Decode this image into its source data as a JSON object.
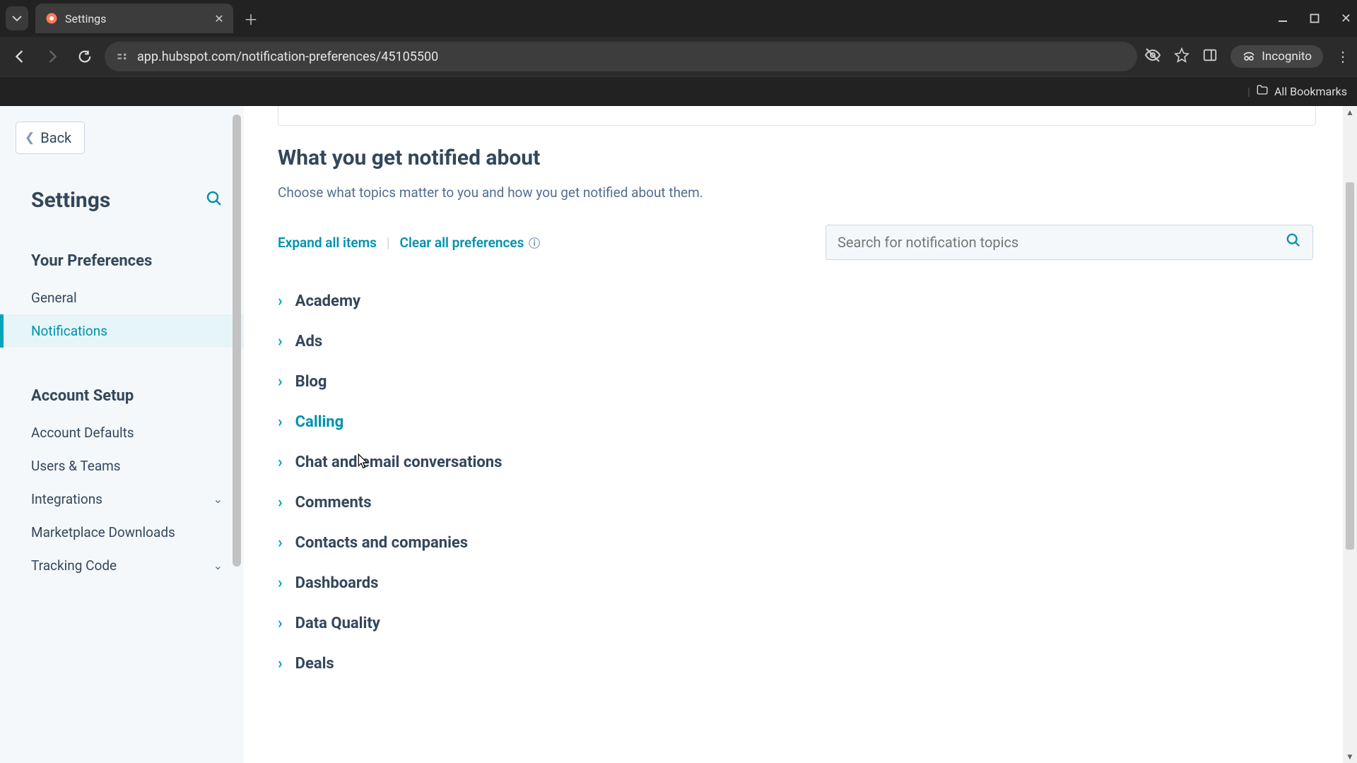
{
  "browser": {
    "tab_title": "Settings",
    "url": "app.hubspot.com/notification-preferences/45105500",
    "incognito": "Incognito",
    "bookmarks": "All Bookmarks"
  },
  "sidebar": {
    "back": "Back",
    "title": "Settings",
    "section1": "Your Preferences",
    "items1": [
      "General",
      "Notifications"
    ],
    "section2": "Account Setup",
    "items2": [
      "Account Defaults",
      "Users & Teams",
      "Integrations",
      "Marketplace Downloads",
      "Tracking Code"
    ]
  },
  "main": {
    "heading": "What you get notified about",
    "subheading": "Choose what topics matter to you and how you get notified about them.",
    "expand": "Expand all items",
    "clear": "Clear all preferences",
    "search_placeholder": "Search for notification topics",
    "topics": [
      "Academy",
      "Ads",
      "Blog",
      "Calling",
      "Chat and email conversations",
      "Comments",
      "Contacts and companies",
      "Dashboards",
      "Data Quality",
      "Deals"
    ]
  }
}
